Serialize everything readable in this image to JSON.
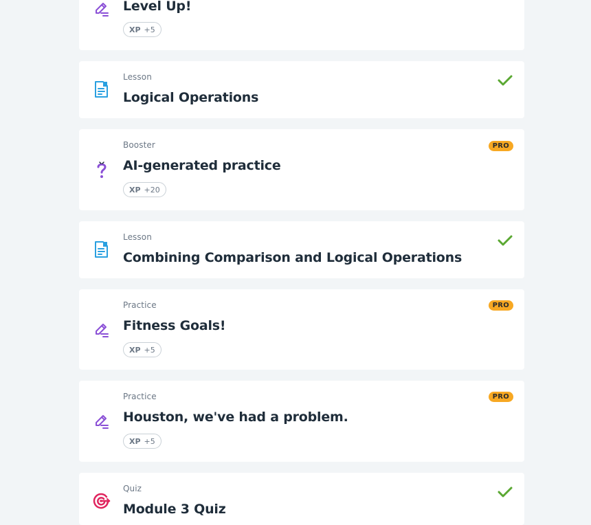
{
  "items": [
    {
      "type": "",
      "title": "Level Up!",
      "xp_label": "XP",
      "xp_value": "+5",
      "icon": "pencil-icon",
      "status": "none"
    },
    {
      "type": "Lesson",
      "title": "Logical Operations",
      "icon": "document-icon",
      "status": "completed"
    },
    {
      "type": "Booster",
      "title": "AI-generated practice",
      "xp_label": "XP",
      "xp_value": "+20",
      "icon": "question-mark-icon",
      "badge": "PRO"
    },
    {
      "type": "Lesson",
      "title": "Combining Comparison and Logical Operations",
      "icon": "document-icon",
      "status": "completed"
    },
    {
      "type": "Practice",
      "title": "Fitness Goals!",
      "xp_label": "XP",
      "xp_value": "+5",
      "icon": "pencil-icon",
      "badge": "PRO"
    },
    {
      "type": "Practice",
      "title": "Houston, we've had a problem.",
      "xp_label": "XP",
      "xp_value": "+5",
      "icon": "pencil-icon",
      "badge": "PRO"
    },
    {
      "type": "Quiz",
      "title": "Module 3 Quiz",
      "icon": "target-icon",
      "status": "completed"
    }
  ],
  "colors": {
    "background": "#f2f5f7",
    "card": "#ffffff",
    "check": "#5aa832",
    "pro_badge": "#f7a823",
    "lesson_icon": "#2aa0e0",
    "practice_icon": "#8a4fd6",
    "quiz_icon": "#e0245e"
  }
}
